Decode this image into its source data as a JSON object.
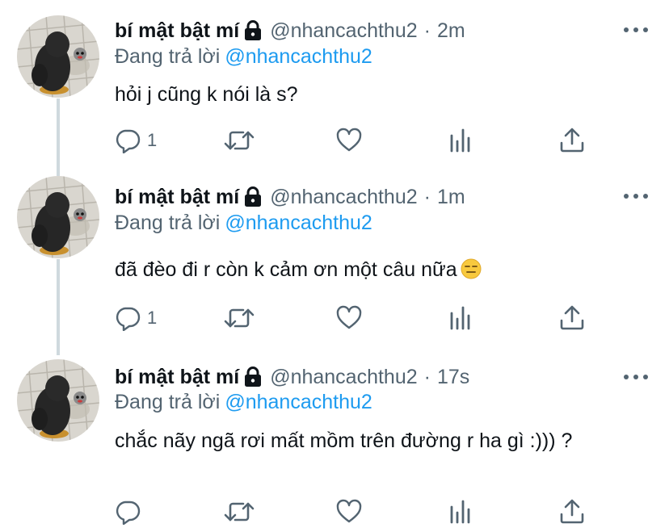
{
  "tweets": [
    {
      "display_name": "bí mật bật mí",
      "handle": "@nhancachthu2",
      "separator": "·",
      "time": "2m",
      "replying_prefix": "Đang trả lời",
      "replying_to": "@nhancachthu2",
      "text": "hỏi j cũng k nói là s?",
      "emoji": "",
      "reply_count": "1"
    },
    {
      "display_name": "bí mật bật mí",
      "handle": "@nhancachthu2",
      "separator": "·",
      "time": "1m",
      "replying_prefix": "Đang trả lời",
      "replying_to": "@nhancachthu2",
      "text": "đã đèo đi r còn k cảm ơn một câu nữa",
      "emoji": "expressionless-face",
      "reply_count": "1"
    },
    {
      "display_name": "bí mật bật mí",
      "handle": "@nhancachthu2",
      "separator": "·",
      "time": "17s",
      "replying_prefix": "Đang trả lời",
      "replying_to": "@nhancachthu2",
      "text": "chắc nãy ngã rơi mất mồm trên đường r ha gì :))) ?",
      "emoji": "",
      "reply_count": ""
    }
  ],
  "colors": {
    "text": "#0f1419",
    "secondary": "#536471",
    "link": "#1d9bf0",
    "thread_line": "#cfd9de"
  },
  "icons": {
    "protected": "lock-icon",
    "reply": "reply-icon",
    "retweet": "retweet-icon",
    "like": "heart-icon",
    "analytics": "analytics-icon",
    "share": "share-icon",
    "more": "more-icon"
  }
}
